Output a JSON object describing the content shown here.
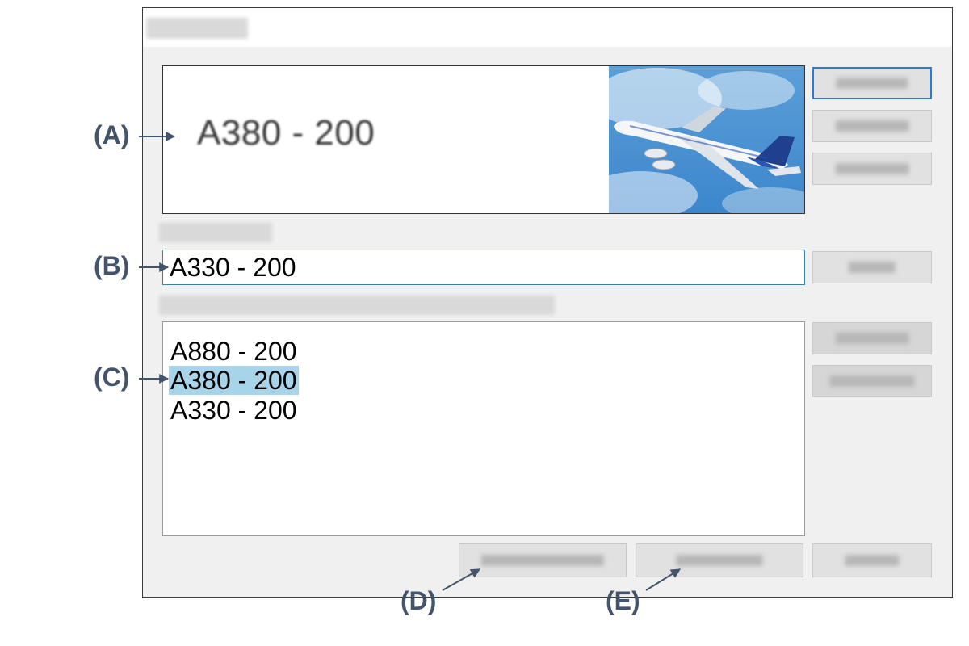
{
  "callouts": {
    "a": "(A)",
    "b": "(B)",
    "c": "(C)",
    "d": "(D)",
    "e": "(E)"
  },
  "preview": {
    "misspelled_word": "A380 - 200",
    "image_icon": "airplane-photo"
  },
  "change_to": {
    "value": "A330 - 200"
  },
  "suggestions": [
    {
      "label": "A880 - 200",
      "selected": false
    },
    {
      "label": "A380 - 200",
      "selected": true
    },
    {
      "label": "A330 - 200",
      "selected": false
    }
  ],
  "colors": {
    "callout": "#44546a",
    "selection": "#a8d4ea",
    "primary_border": "#2b7bd1"
  }
}
